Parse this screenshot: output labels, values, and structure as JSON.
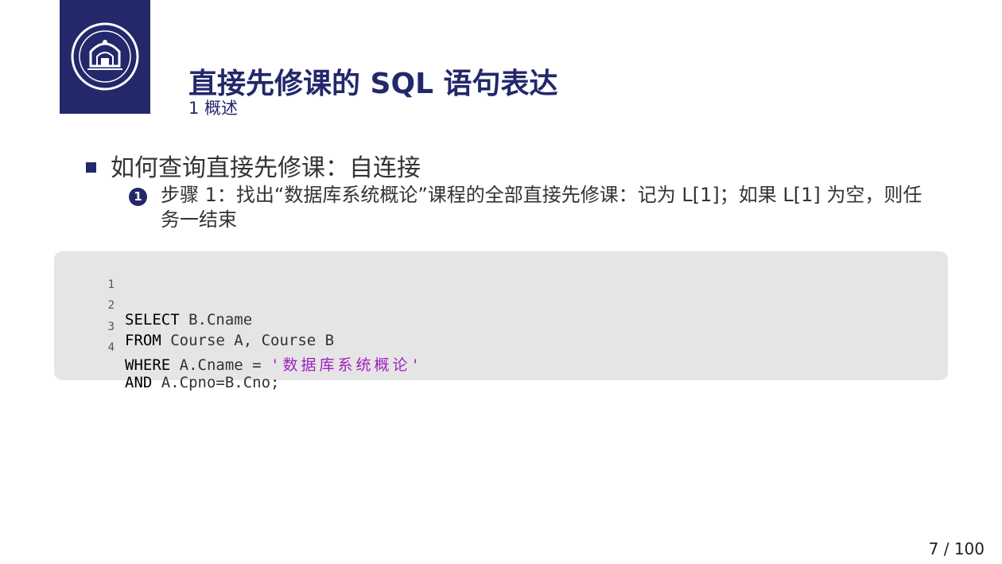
{
  "slide": {
    "title": "直接先修课的 SQL 语句表达",
    "section": "1 概述",
    "bullet": "如何查询直接先修课：自连接",
    "step_number": "1",
    "step_text": "步骤 1：找出“数据库系统概论”课程的全部直接先修课：记为 L[1]；如果 L[1] 为空，则任务一结束",
    "page_number": "7 / 100"
  },
  "code": {
    "lines": [
      {
        "num": "1",
        "kw": "SELECT",
        "rest": " B.Cname",
        "str": ""
      },
      {
        "num": "2",
        "kw": "FROM",
        "rest": " Course A, Course B",
        "str": ""
      },
      {
        "num": "3",
        "kw": "WHERE",
        "rest": " A.Cname = ",
        "str": "'数据库系统概论'"
      },
      {
        "num": "4",
        "kw": "AND",
        "rest": " A.Cpno=B.Cno;",
        "str": ""
      }
    ]
  },
  "colors": {
    "brand_navy": "#23286b",
    "code_bg": "#e5e5e5",
    "string_purple": "#a020c0"
  },
  "icons": {
    "logo": "university-seal-icon"
  }
}
